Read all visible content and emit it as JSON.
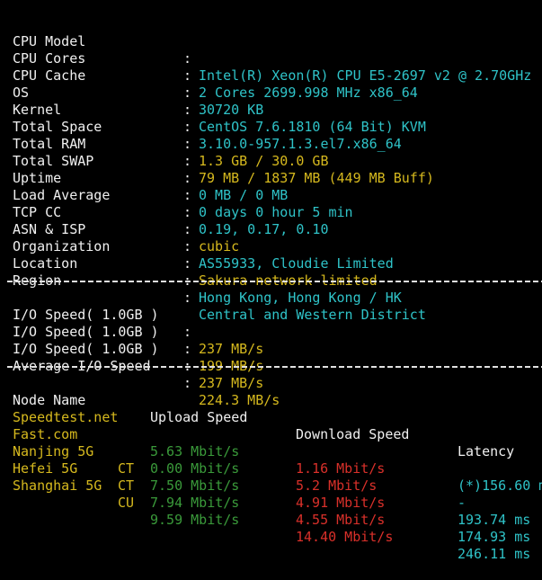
{
  "system_info": [
    {
      "label": "CPU Model",
      "value": "Intel(R) Xeon(R) CPU E5-2697 v2 @ 2.70GHz",
      "color": "cyan"
    },
    {
      "label": "CPU Cores",
      "value": "2 Cores 2699.998 MHz x86_64",
      "color": "cyan"
    },
    {
      "label": "CPU Cache",
      "value": "30720 KB",
      "color": "cyan"
    },
    {
      "label": "OS",
      "value": "CentOS 7.6.1810 (64 Bit) KVM",
      "color": "cyan"
    },
    {
      "label": "Kernel",
      "value": "3.10.0-957.1.3.el7.x86_64",
      "color": "cyan"
    },
    {
      "label": "Total Space",
      "value": "1.3 GB / 30.0 GB",
      "color": "yellow"
    },
    {
      "label": "Total RAM",
      "value": "79 MB / 1837 MB (449 MB Buff)",
      "color": "yellow"
    },
    {
      "label": "Total SWAP",
      "value": "0 MB / 0 MB",
      "color": "cyan"
    },
    {
      "label": "Uptime",
      "value": "0 days 0 hour 5 min",
      "color": "cyan"
    },
    {
      "label": "Load Average",
      "value": "0.19, 0.17, 0.10",
      "color": "cyan"
    },
    {
      "label": "TCP CC",
      "value": "cubic",
      "color": "yellow"
    },
    {
      "label": "ASN & ISP",
      "value": "AS55933, Cloudie Limited",
      "color": "cyan"
    },
    {
      "label": "Organization",
      "value": "Sakura network limited",
      "color": "yellow"
    },
    {
      "label": "Location",
      "value": "Hong Kong, Hong Kong / HK",
      "color": "cyan"
    },
    {
      "label": "Region",
      "value": "Central and Western District",
      "color": "cyan"
    }
  ],
  "separator": ":",
  "io_speed": [
    {
      "label": "I/O Speed( 1.0GB )",
      "value": "237 MB/s"
    },
    {
      "label": "I/O Speed( 1.0GB )",
      "value": "199 MB/s"
    },
    {
      "label": "I/O Speed( 1.0GB )",
      "value": "237 MB/s"
    },
    {
      "label": "Average I/O Speed",
      "value": "224.3 MB/s"
    }
  ],
  "speedtest": {
    "headers": {
      "node": "Node Name",
      "upload": "Upload Speed",
      "download": "Download Speed",
      "latency": "Latency"
    },
    "rows": [
      {
        "node": "Speedtest.net",
        "isp": "",
        "upload": "5.63 Mbit/s",
        "download": "1.16 Mbit/s",
        "latency": "(*)156.60 m"
      },
      {
        "node": "Fast.com",
        "isp": "",
        "upload": "0.00 Mbit/s",
        "download": "5.2 Mbit/s",
        "latency": "-"
      },
      {
        "node": "Nanjing 5G",
        "isp": "CT",
        "upload": "7.50 Mbit/s",
        "download": "4.91 Mbit/s",
        "latency": "193.74 ms"
      },
      {
        "node": "Hefei 5G",
        "isp": "CT",
        "upload": "7.94 Mbit/s",
        "download": "4.55 Mbit/s",
        "latency": "174.93 ms"
      },
      {
        "node": "Shanghai 5G",
        "isp": "CU",
        "upload": "9.59 Mbit/s",
        "download": "14.40 Mbit/s",
        "latency": "246.11 ms"
      }
    ]
  },
  "colors": {
    "background": "#000000",
    "label": "#f0f0f0",
    "cyan": "#2fc3c8",
    "yellow": "#d6b91e",
    "green": "#3a9a3a",
    "red": "#d9302a"
  }
}
